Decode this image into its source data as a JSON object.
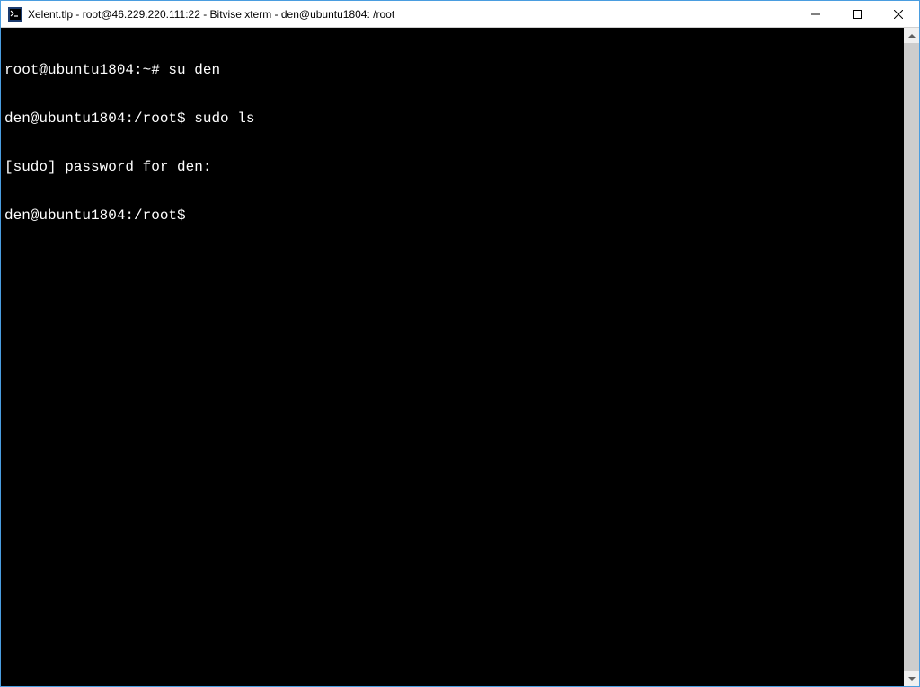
{
  "window": {
    "title": "Xelent.tlp - root@46.229.220.111:22 - Bitvise xterm - den@ubuntu1804: /root"
  },
  "terminal": {
    "lines": [
      "root@ubuntu1804:~# su den",
      "den@ubuntu1804:/root$ sudo ls",
      "[sudo] password for den:",
      "den@ubuntu1804:/root$"
    ]
  },
  "icons": {
    "app": "bitvise-terminal-icon",
    "minimize": "minimize-icon",
    "maximize": "maximize-icon",
    "close": "close-icon"
  }
}
